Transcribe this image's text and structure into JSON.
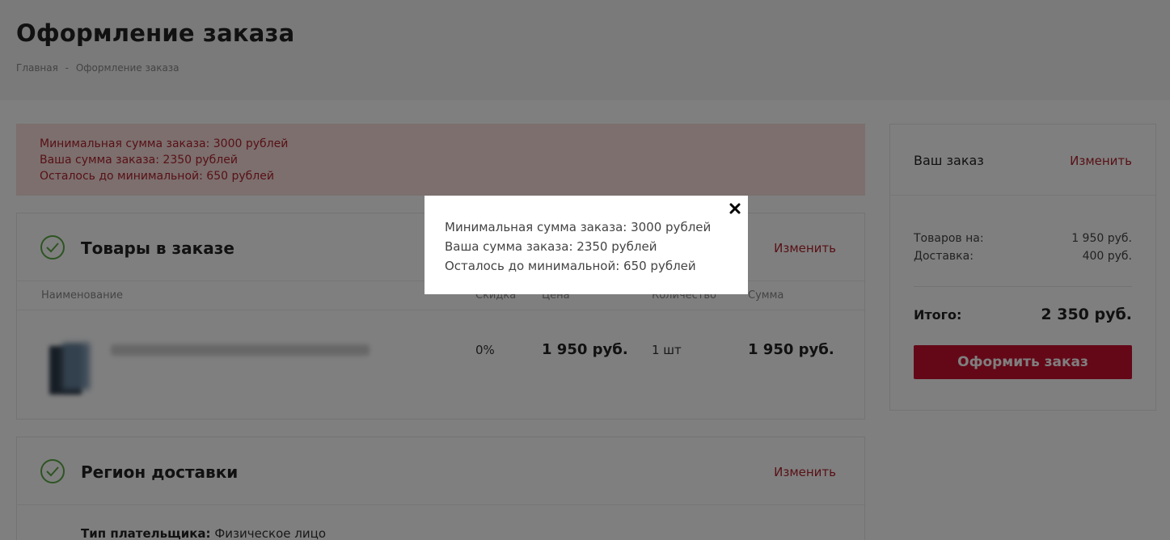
{
  "page": {
    "title": "Оформление заказа",
    "breadcrumb": [
      "Главная",
      "-",
      "Оформление заказа"
    ]
  },
  "alert": {
    "lines": [
      "Минимальная сумма заказа: 3000 рублей",
      "Ваша сумма заказа: 2350 рублей",
      "Осталось до минимальной: 650 рублей"
    ]
  },
  "goods": {
    "title": "Товары в заказе",
    "change_label": "Изменить",
    "columns": [
      "Наименование",
      "Скидка",
      "Цена",
      "Количество",
      "Сумма"
    ],
    "row": {
      "discount": "0%",
      "price": "1 950 руб.",
      "quantity": "1 шт",
      "sum": "1 950 руб."
    }
  },
  "region": {
    "title": "Регион доставки",
    "change_label": "Изменить",
    "payer_label": "Тип плательщика:",
    "payer_value": "Физическое лицо"
  },
  "sidebar": {
    "title": "Ваш заказ",
    "change_label": "Изменить",
    "goods_label": "Товаров на:",
    "goods_value": "1 950 руб.",
    "delivery_label": "Доставка:",
    "delivery_value": "400 руб.",
    "total_label": "Итого:",
    "total_value": "2 350 руб.",
    "order_button": "Оформить заказ"
  },
  "modal": {
    "lines": [
      "Минимальная сумма заказа: 3000 рублей",
      "Ваша сумма заказа: 2350 рублей",
      "Осталось до минимальной: 650 рублей"
    ],
    "close_icon": "close-icon"
  },
  "colors": {
    "accent": "#c8102e",
    "alert_text": "#b0222c",
    "alert_bg": "#f9dedc",
    "check": "#5aa844"
  }
}
